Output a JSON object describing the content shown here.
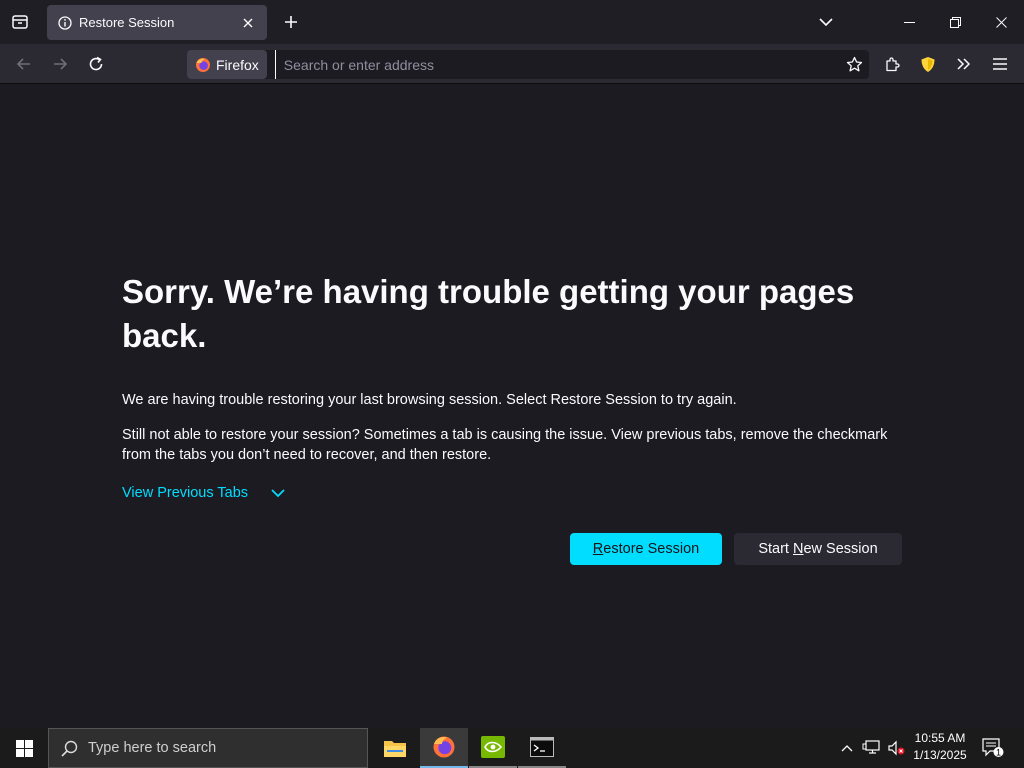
{
  "browser": {
    "tab": {
      "title": "Restore Session"
    },
    "identity_label": "Firefox",
    "url_placeholder": "Search or enter address"
  },
  "page": {
    "headline": "Sorry. We’re having trouble getting your pages back.",
    "paragraph1": "We are having trouble restoring your last browsing session. Select Restore Session to try again.",
    "paragraph2": "Still not able to restore your session? Sometimes a tab is causing the issue. View previous tabs, remove the checkmark from the tabs you don’t need to recover, and then restore.",
    "view_tabs_label": "View Previous Tabs",
    "restore_button": {
      "prefix": "",
      "accel": "R",
      "suffix": "estore Session"
    },
    "new_session_button": {
      "prefix": "Start ",
      "accel": "N",
      "suffix": "ew Session"
    }
  },
  "taskbar": {
    "search_placeholder": "Type here to search",
    "time": "10:55 AM",
    "date": "1/13/2025",
    "notification_count": "1"
  },
  "colors": {
    "accent": "#00ddff",
    "page_bg": "#1c1b22",
    "toolbar_bg": "#2b2a33"
  }
}
